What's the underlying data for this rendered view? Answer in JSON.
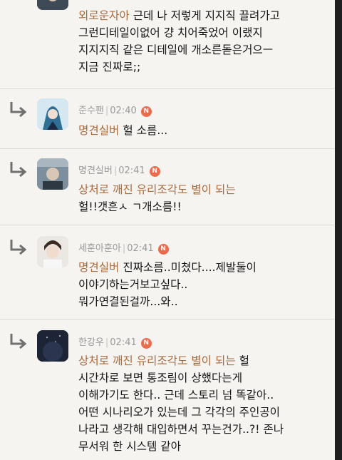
{
  "comments": [
    {
      "author": "",
      "time": "",
      "lines": [
        {
          "mention": "외로운자아",
          "text": " 근데 나 저렇게 지지직 끌려가고"
        },
        {
          "text": "그런디테일이없어 걍 치어죽었어 이랬지"
        },
        {
          "text": "지지지직 같은 디테일에 개소른돋은거으ㅡ"
        },
        {
          "text": "지금 진짜로;;"
        }
      ]
    },
    {
      "author": "준수팬",
      "time": "02:40",
      "badge": "N",
      "lines": [
        {
          "mention": "명견실버",
          "text": " 헐 소름..."
        }
      ]
    },
    {
      "author": "명견실버",
      "time": "02:41",
      "badge": "N",
      "lines": [
        {
          "mention": "상처로 깨진 유리조각도 별이 되는"
        },
        {
          "text": "헐!!갯흔ㅅ ㄱ개소름!!"
        }
      ]
    },
    {
      "author": "세훈아훈아",
      "time": "02:41",
      "badge": "N",
      "lines": [
        {
          "mention": "명견실버",
          "text": " 진짜소름..미쳤다....제발둘이"
        },
        {
          "text": "이야기하는거보고싶다.."
        },
        {
          "text": "뭐가연결된걸까...와.."
        }
      ]
    },
    {
      "author": "한강우",
      "time": "02:41",
      "badge": "N",
      "lines": [
        {
          "mention": "상처로 깨진 유리조각도 별이 되는",
          "text": " 헐"
        },
        {
          "text": "시간차로 보면 통조림이 상했다는게"
        },
        {
          "text": "이해가기도 한다.. 근데 스토리 넘 똑같아.."
        },
        {
          "text": "어떤 시나리오가 있는데 그 각각의 주인공이"
        },
        {
          "text": "나라고 생각해 대입하면서 꾸는건가..?! 존나"
        },
        {
          "text": "무서워 한 시스템 같아"
        }
      ]
    }
  ],
  "colors": {
    "mention": "#a8693c",
    "badge": "#ec6a4c",
    "meta": "#9a9a9a"
  },
  "icons": {
    "reply": "reply-arrow-icon",
    "badge": "new-badge-icon"
  }
}
